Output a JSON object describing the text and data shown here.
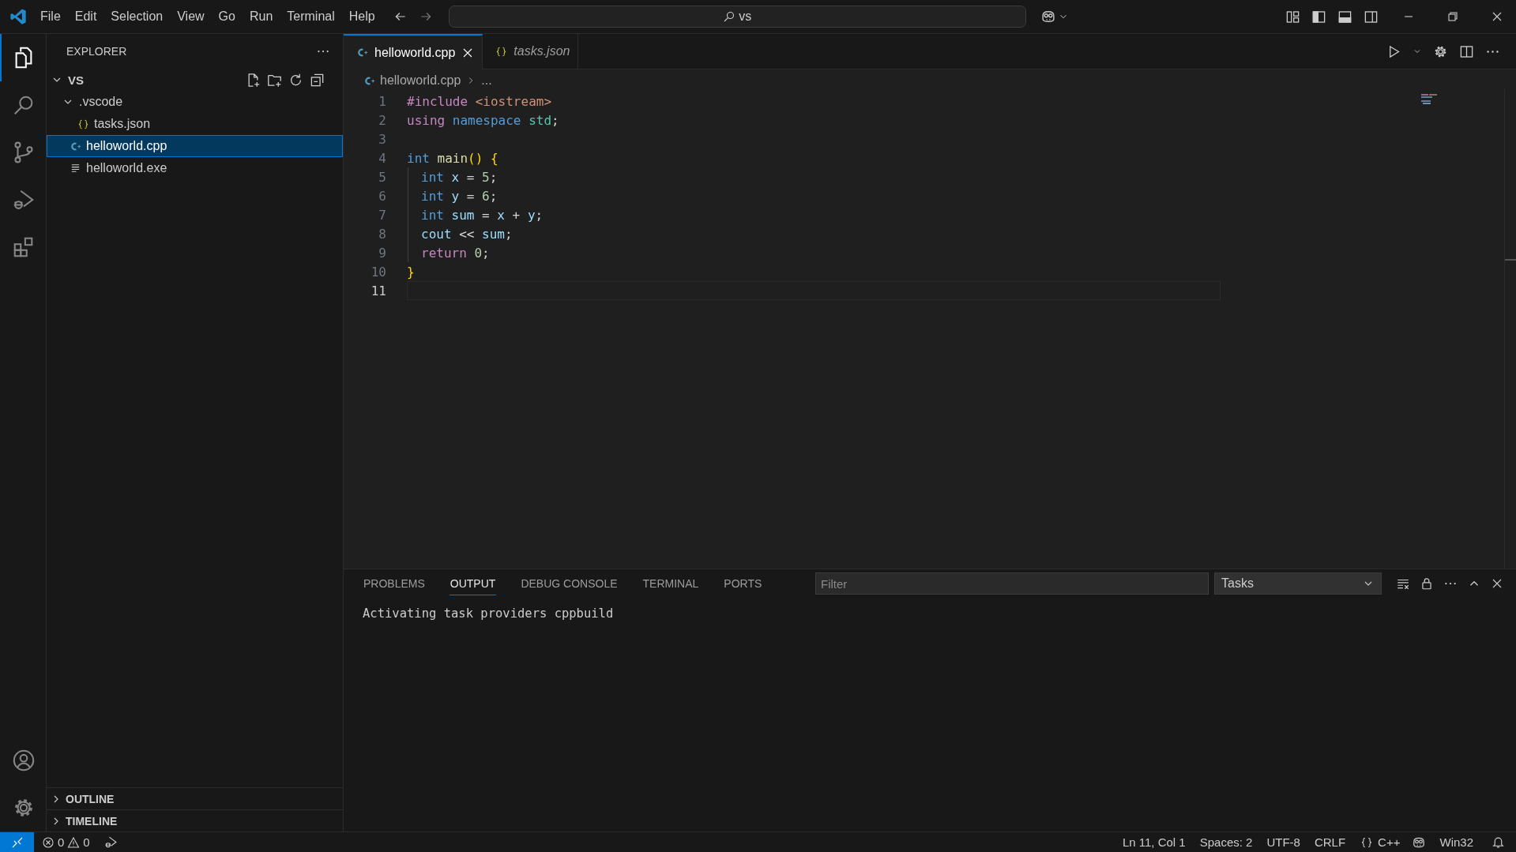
{
  "menu_bar": {
    "items": [
      "File",
      "Edit",
      "Selection",
      "View",
      "Go",
      "Run",
      "Terminal",
      "Help"
    ]
  },
  "command_center": {
    "value": "vs"
  },
  "activity_bar": {
    "items": [
      {
        "kind": "files",
        "selected": true
      },
      {
        "kind": "search",
        "selected": false
      },
      {
        "kind": "scm",
        "selected": false
      },
      {
        "kind": "debug",
        "selected": false
      },
      {
        "kind": "ext",
        "selected": false
      }
    ],
    "bottom": [
      {
        "kind": "account"
      },
      {
        "kind": "gear"
      }
    ]
  },
  "sidebar": {
    "title": "EXPLORER",
    "folder": {
      "label": "VS",
      "expanded": true,
      "children": [
        {
          "label": ".vscode",
          "kind": "folder",
          "expanded": true,
          "children": [
            {
              "label": "tasks.json",
              "kind": "json",
              "selected": false
            }
          ]
        },
        {
          "label": "helloworld.cpp",
          "kind": "cpp",
          "selected": true
        },
        {
          "label": "helloworld.exe",
          "kind": "file",
          "selected": false
        }
      ]
    },
    "sections": [
      {
        "label": "OUTLINE",
        "expanded": false
      },
      {
        "label": "TIMELINE",
        "expanded": false
      }
    ]
  },
  "editor": {
    "tabs": [
      {
        "label": "helloworld.cpp",
        "kind": "cpp",
        "selected": true,
        "preview": false
      },
      {
        "label": "tasks.json",
        "kind": "json",
        "selected": false,
        "preview": true
      }
    ],
    "breadcrumb": [
      "helloworld.cpp",
      "..."
    ],
    "lines": [
      {
        "number": "1",
        "current": false,
        "indent_guide": false,
        "tokens": [
          {
            "text": "#include ",
            "kind": "directive"
          },
          {
            "text": "<iostream>",
            "kind": "string"
          }
        ]
      },
      {
        "number": "2",
        "current": false,
        "indent_guide": false,
        "tokens": [
          {
            "text": "using ",
            "kind": "directive"
          },
          {
            "text": "namespace ",
            "kind": "keyword"
          },
          {
            "text": "std",
            "kind": "namespace"
          },
          {
            "text": ";",
            "kind": "plain"
          }
        ]
      },
      {
        "number": "3",
        "current": false,
        "indent_guide": false
      },
      {
        "number": "4",
        "current": false,
        "indent_guide": false,
        "tokens": [
          {
            "text": "int ",
            "kind": "keyword"
          },
          {
            "text": "main",
            "kind": "function"
          },
          {
            "text": "() {",
            "kind": "bracket"
          }
        ]
      },
      {
        "number": "5",
        "current": false,
        "indent_guide": true,
        "tokens": [
          {
            "text": "int ",
            "kind": "keyword"
          },
          {
            "text": "x",
            "kind": "variable"
          },
          {
            "text": " = ",
            "kind": "plain"
          },
          {
            "text": "5",
            "kind": "number"
          },
          {
            "text": ";",
            "kind": "plain"
          }
        ]
      },
      {
        "number": "6",
        "current": false,
        "indent_guide": true,
        "tokens": [
          {
            "text": "int ",
            "kind": "keyword"
          },
          {
            "text": "y",
            "kind": "variable"
          },
          {
            "text": " = ",
            "kind": "plain"
          },
          {
            "text": "6",
            "kind": "number"
          },
          {
            "text": ";",
            "kind": "plain"
          }
        ]
      },
      {
        "number": "7",
        "current": false,
        "indent_guide": true,
        "tokens": [
          {
            "text": "int ",
            "kind": "keyword"
          },
          {
            "text": "sum",
            "kind": "variable"
          },
          {
            "text": " = ",
            "kind": "plain"
          },
          {
            "text": "x",
            "kind": "variable"
          },
          {
            "text": " + ",
            "kind": "plain"
          },
          {
            "text": "y",
            "kind": "variable"
          },
          {
            "text": ";",
            "kind": "plain"
          }
        ]
      },
      {
        "number": "8",
        "current": false,
        "indent_guide": true,
        "tokens": [
          {
            "text": "cout",
            "kind": "variable"
          },
          {
            "text": " << ",
            "kind": "plain"
          },
          {
            "text": "sum",
            "kind": "variable"
          },
          {
            "text": ";",
            "kind": "plain"
          }
        ]
      },
      {
        "number": "9",
        "current": false,
        "indent_guide": true,
        "tokens": [
          {
            "text": "return ",
            "kind": "directive"
          },
          {
            "text": "0",
            "kind": "number"
          },
          {
            "text": ";",
            "kind": "plain"
          }
        ]
      },
      {
        "number": "10",
        "current": false,
        "indent_guide": false,
        "tokens": [
          {
            "text": "}",
            "kind": "bracket"
          }
        ]
      },
      {
        "number": "11",
        "current": true,
        "indent_guide": false
      }
    ]
  },
  "panel": {
    "tabs": [
      {
        "label": "PROBLEMS",
        "selected": false
      },
      {
        "label": "OUTPUT",
        "selected": true
      },
      {
        "label": "DEBUG CONSOLE",
        "selected": false
      },
      {
        "label": "TERMINAL",
        "selected": false
      },
      {
        "label": "PORTS",
        "selected": false
      }
    ],
    "filter": {
      "placeholder": "Filter"
    },
    "channel": {
      "value": "Tasks"
    },
    "output": [
      "Activating task providers cppbuild"
    ]
  },
  "status_bar": {
    "errors": "0",
    "warnings": "0",
    "items": [
      "Ln 11, Col 1",
      "Spaces: 2",
      "UTF-8",
      "CRLF"
    ],
    "language": "C++",
    "platform": "Win32"
  }
}
